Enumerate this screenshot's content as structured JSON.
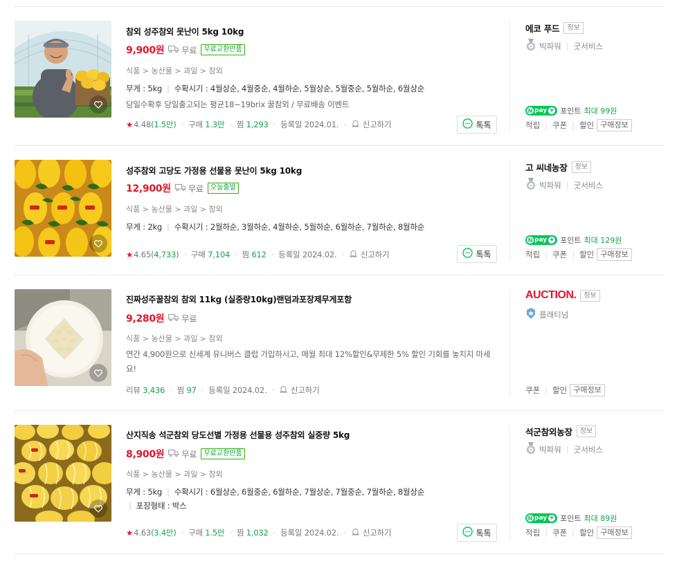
{
  "colors": {
    "price": "#e0162b",
    "green": "#16a34a",
    "npay": "#03c75a"
  },
  "items": [
    {
      "title": "참외 성주참외 못난이 5kg 10kg",
      "price": "9,900원",
      "shipping": "무료",
      "tag": "무료교환반품",
      "category": [
        "식품",
        "농산물",
        "과일",
        "참외"
      ],
      "spec_weight": "무게 : 5kg",
      "spec_harvest": "수확시기 : 4월상순, 4월중순, 4월하순, 5월상순, 5월중순, 5월하순, 6월상순",
      "desc": "당일수확후 당일출고되는 평균18~19brix 꿀참외 / 무료배송 이벤트",
      "rating": "4.48",
      "rating_count": "(1.5만)",
      "purchase_label": "구매",
      "purchase": "1.3만",
      "wish_label": "찜",
      "wish": "1,293",
      "reg": "등록일 2024.01.",
      "report": "신고하기",
      "talk": "톡톡",
      "mall": "에코 푸드",
      "mall_info": "정보",
      "grade1": "빅파워",
      "grade2": "굿서비스",
      "npay_label": "pay",
      "point_label": "포인트",
      "point": "최대 99원",
      "links": [
        "적립",
        "쿠폰",
        "할인"
      ],
      "buy_info": "구매정보"
    },
    {
      "title": "성주참외 고당도 가정용 선물용 못난이 5kg 10kg",
      "price": "12,900원",
      "shipping": "무료",
      "tag": "오늘출발",
      "category": [
        "식품",
        "농산물",
        "과일",
        "참외"
      ],
      "spec_weight": "무게 : 2kg",
      "spec_harvest": "수확시기 : 2월하순, 3월하순, 4월하순, 5월하순, 6월하순, 7월하순, 8월하순",
      "rating": "4.65",
      "rating_count": "(4,733)",
      "purchase_label": "구매",
      "purchase": "7,104",
      "wish_label": "찜",
      "wish": "612",
      "reg": "등록일 2024.02.",
      "report": "신고하기",
      "talk": "톡톡",
      "mall": "고 씨네농장",
      "mall_info": "정보",
      "grade1": "빅파워",
      "grade2": "굿서비스",
      "npay_label": "pay",
      "point_label": "포인트",
      "point": "최대 129원",
      "links": [
        "적립",
        "쿠폰",
        "할인"
      ],
      "buy_info": "구매정보"
    },
    {
      "title": "진짜성주꿀참외 참외 11kg (실중량10kg)랜덤과포장제무게포함",
      "price": "9,280원",
      "shipping": "무료",
      "category": [
        "식품",
        "농산물",
        "과일",
        "참외"
      ],
      "desc": "연간 4,900원으로 신세계 유니버스 클럽 가입하시고, 매월 최대 12%할인&무제한 5% 할인 기회를 놓치지 마세요!",
      "review_label": "리뷰",
      "review": "3,436",
      "wish_label": "찜",
      "wish": "97",
      "reg": "등록일 2024.02.",
      "report": "신고하기",
      "mall": "AUCTION.",
      "mall_info": "정보",
      "grade1": "플래티넘",
      "links": [
        "쿠폰",
        "할인"
      ],
      "buy_info": "구매정보"
    },
    {
      "title": "산지직송 석군참외 당도선별 가정용 선물용 성주참외 실중량 5kg",
      "price": "8,900원",
      "shipping": "무료",
      "tag": "무료교환반품",
      "category": [
        "식품",
        "농산물",
        "과일",
        "참외"
      ],
      "spec_weight": "무게 : 5kg",
      "spec_harvest": "수확시기 : 6월상순, 6월중순, 6월하순, 7월상순, 7월중순, 7월하순, 8월상순",
      "spec_pack": "포장형태 : 박스",
      "rating": "4.63",
      "rating_count": "(3.4만)",
      "purchase_label": "구매",
      "purchase": "1.5만",
      "wish_label": "찜",
      "wish": "1,032",
      "reg": "등록일 2024.02.",
      "report": "신고하기",
      "talk": "톡톡",
      "mall": "석군참외농장",
      "mall_info": "정보",
      "grade1": "빅파워",
      "grade2": "굿서비스",
      "npay_label": "pay",
      "point_label": "포인트",
      "point": "최대 89원",
      "links": [
        "적립",
        "쿠폰",
        "할인"
      ],
      "buy_info": "구매정보"
    }
  ]
}
